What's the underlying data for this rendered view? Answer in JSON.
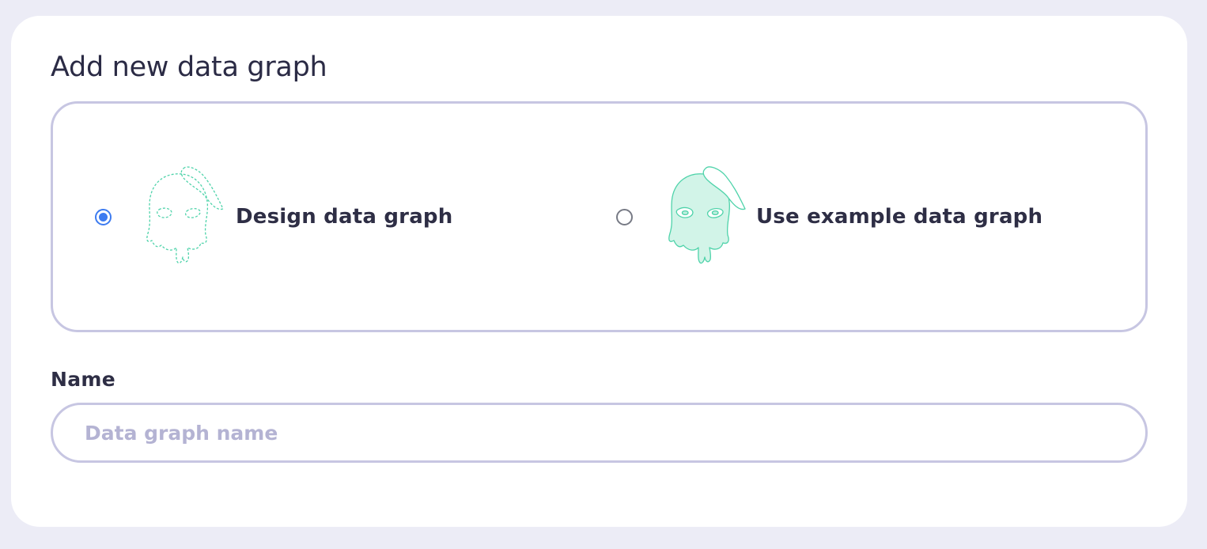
{
  "dialog": {
    "title": "Add new data graph"
  },
  "options": [
    {
      "label": "Design data graph",
      "selected": true,
      "icon": "dashed-outline-mascot-icon"
    },
    {
      "label": "Use example data graph",
      "selected": false,
      "icon": "filled-mascot-icon"
    }
  ],
  "name_field": {
    "label": "Name",
    "placeholder": "Data graph name",
    "value": ""
  },
  "colors": {
    "background": "#ececf6",
    "card": "#ffffff",
    "border": "#c7c6e2",
    "accent": "#3d7bf0",
    "mascot_fill": "#d2f4e8",
    "mascot_stroke": "#4fd3aa",
    "text": "#2e2e45",
    "placeholder": "#b4b3d3"
  }
}
